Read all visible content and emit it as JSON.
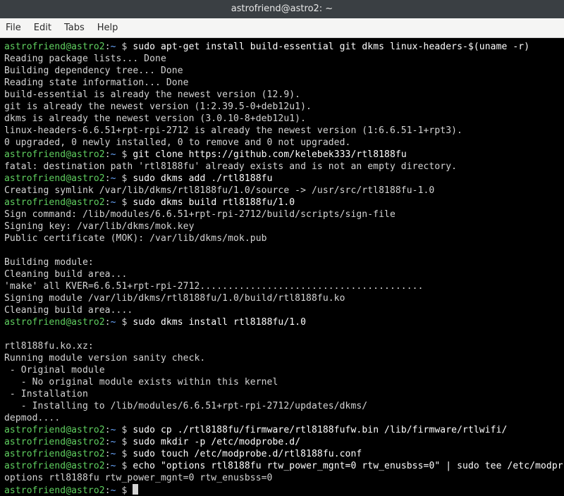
{
  "window": {
    "title": "astrofriend@astro2: ~"
  },
  "menubar": {
    "file": "File",
    "edit": "Edit",
    "tabs": "Tabs",
    "help": "Help"
  },
  "prompt": {
    "userhost": "astrofriend@astro2",
    "colon": ":",
    "path": "~",
    "dollar": " $ "
  },
  "lines": [
    {
      "type": "prompt",
      "cmd": "sudo apt-get install build-essential git dkms linux-headers-$(uname -r)"
    },
    {
      "type": "out",
      "text": "Reading package lists... Done"
    },
    {
      "type": "out",
      "text": "Building dependency tree... Done"
    },
    {
      "type": "out",
      "text": "Reading state information... Done"
    },
    {
      "type": "out",
      "text": "build-essential is already the newest version (12.9)."
    },
    {
      "type": "out",
      "text": "git is already the newest version (1:2.39.5-0+deb12u1)."
    },
    {
      "type": "out",
      "text": "dkms is already the newest version (3.0.10-8+deb12u1)."
    },
    {
      "type": "out",
      "text": "linux-headers-6.6.51+rpt-rpi-2712 is already the newest version (1:6.6.51-1+rpt3)."
    },
    {
      "type": "out",
      "text": "0 upgraded, 0 newly installed, 0 to remove and 0 not upgraded."
    },
    {
      "type": "prompt",
      "cmd": "git clone https://github.com/kelebek333/rtl8188fu"
    },
    {
      "type": "out",
      "text": "fatal: destination path 'rtl8188fu' already exists and is not an empty directory."
    },
    {
      "type": "prompt",
      "cmd": "sudo dkms add ./rtl8188fu"
    },
    {
      "type": "out",
      "text": "Creating symlink /var/lib/dkms/rtl8188fu/1.0/source -> /usr/src/rtl8188fu-1.0"
    },
    {
      "type": "prompt",
      "cmd": "sudo dkms build rtl8188fu/1.0"
    },
    {
      "type": "out",
      "text": "Sign command: /lib/modules/6.6.51+rpt-rpi-2712/build/scripts/sign-file"
    },
    {
      "type": "out",
      "text": "Signing key: /var/lib/dkms/mok.key"
    },
    {
      "type": "out",
      "text": "Public certificate (MOK): /var/lib/dkms/mok.pub"
    },
    {
      "type": "out",
      "text": ""
    },
    {
      "type": "out",
      "text": "Building module:"
    },
    {
      "type": "out",
      "text": "Cleaning build area..."
    },
    {
      "type": "out",
      "text": "'make' all KVER=6.6.51+rpt-rpi-2712........................................"
    },
    {
      "type": "out",
      "text": "Signing module /var/lib/dkms/rtl8188fu/1.0/build/rtl8188fu.ko"
    },
    {
      "type": "out",
      "text": "Cleaning build area...."
    },
    {
      "type": "prompt",
      "cmd": "sudo dkms install rtl8188fu/1.0"
    },
    {
      "type": "out",
      "text": ""
    },
    {
      "type": "out",
      "text": "rtl8188fu.ko.xz:"
    },
    {
      "type": "out",
      "text": "Running module version sanity check."
    },
    {
      "type": "out",
      "text": " - Original module"
    },
    {
      "type": "out",
      "text": "   - No original module exists within this kernel"
    },
    {
      "type": "out",
      "text": " - Installation"
    },
    {
      "type": "out",
      "text": "   - Installing to /lib/modules/6.6.51+rpt-rpi-2712/updates/dkms/"
    },
    {
      "type": "out",
      "text": "depmod...."
    },
    {
      "type": "prompt",
      "cmd": "sudo cp ./rtl8188fu/firmware/rtl8188fufw.bin /lib/firmware/rtlwifi/"
    },
    {
      "type": "prompt",
      "cmd": "sudo mkdir -p /etc/modprobe.d/"
    },
    {
      "type": "prompt",
      "cmd": "sudo touch /etc/modprobe.d/rtl8188fu.conf"
    },
    {
      "type": "prompt",
      "cmd": "echo \"options rtl8188fu rtw_power_mgnt=0 rtw_enusbss=0\" | sudo tee /etc/modpr"
    },
    {
      "type": "out",
      "text": "options rtl8188fu rtw_power_mgnt=0 rtw_enusbss=0"
    },
    {
      "type": "prompt",
      "cmd": "",
      "cursor": true
    }
  ]
}
